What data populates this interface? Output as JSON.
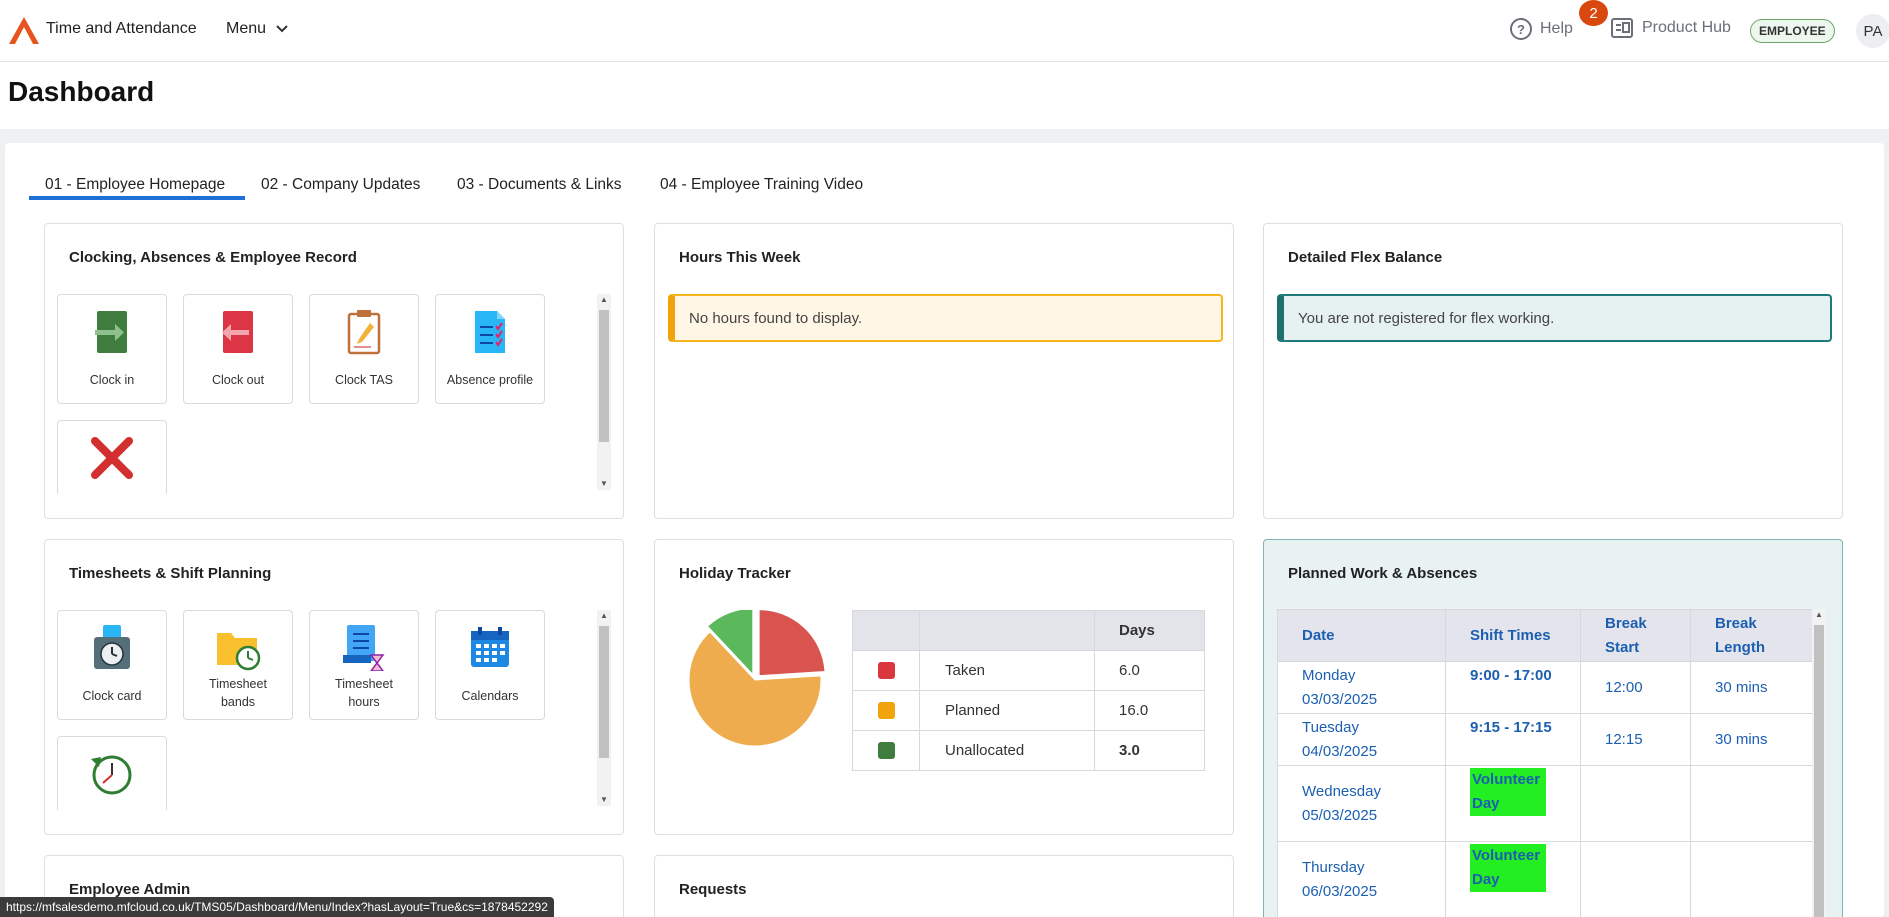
{
  "header": {
    "app_title": "Time and Attendance",
    "menu_label": "Menu",
    "help_label": "Help",
    "notification_count": "2",
    "product_hub_label": "Product Hub",
    "role_badge": "EMPLOYEE",
    "avatar_initials": "PA"
  },
  "page": {
    "title": "Dashboard"
  },
  "tabs": [
    {
      "label": "01 - Employee Homepage",
      "active": true
    },
    {
      "label": "02 - Company Updates",
      "active": false
    },
    {
      "label": "03 - Documents & Links",
      "active": false
    },
    {
      "label": "04 - Employee Training Video",
      "active": false
    }
  ],
  "clocking_panel": {
    "title": "Clocking, Absences & Employee Record",
    "tiles": [
      {
        "label": "Clock in",
        "icon": "clock-in-icon"
      },
      {
        "label": "Clock out",
        "icon": "clock-out-icon"
      },
      {
        "label": "Clock TAS",
        "icon": "clipboard-icon"
      },
      {
        "label": "Absence profile",
        "icon": "checklist-icon"
      },
      {
        "label": "",
        "icon": "red-cross-icon"
      }
    ]
  },
  "hours_panel": {
    "title": "Hours This Week",
    "message": "No hours found to display."
  },
  "flex_panel": {
    "title": "Detailed Flex Balance",
    "message": "You are not registered for flex working."
  },
  "timesheets_panel": {
    "title": "Timesheets & Shift Planning",
    "tiles": [
      {
        "label": "Clock card",
        "icon": "clock-card-icon"
      },
      {
        "label_line1": "Timesheet",
        "label_line2": "bands",
        "icon": "folder-clock-icon"
      },
      {
        "label_line1": "Timesheet",
        "label_line2": "hours",
        "icon": "timesheet-hourglass-icon"
      },
      {
        "label": "Calendars",
        "icon": "calendar-icon"
      },
      {
        "label": "",
        "icon": "history-clock-icon"
      }
    ]
  },
  "holiday_panel": {
    "title": "Holiday Tracker",
    "table_header_days": "Days",
    "rows": [
      {
        "label": "Taken",
        "days": "6.0",
        "color": "#d9363e"
      },
      {
        "label": "Planned",
        "days": "16.0",
        "color": "#f0a30a"
      },
      {
        "label": "Unallocated",
        "days": "3.0",
        "color": "#3e7d3e"
      }
    ],
    "pie_slices": [
      {
        "label": "Taken",
        "value": 6.0,
        "color": "#d9534f"
      },
      {
        "label": "Planned",
        "value": 16.0,
        "color": "#eeac4e"
      },
      {
        "label": "Unallocated",
        "value": 3.0,
        "color": "#5cb85c"
      }
    ]
  },
  "planned_panel": {
    "title": "Planned Work & Absences",
    "headers": [
      "Date",
      "Shift Times",
      "Break Start",
      "Break Length"
    ],
    "header_lines": {
      "break_start_1": "Break",
      "break_start_2": "Start",
      "break_length_1": "Break",
      "break_length_2": "Length"
    },
    "rows": [
      {
        "day": "Monday",
        "date": "03/03/2025",
        "shift": "9:00 - 17:00",
        "break_start": "12:00",
        "break_length": "30 mins"
      },
      {
        "day": "Tuesday",
        "date": "04/03/2025",
        "shift": "9:15 - 17:15",
        "break_start": "12:15",
        "break_length": "30 mins"
      },
      {
        "day": "Wednesday",
        "date": "05/03/2025",
        "shift_line1": "Volunteer",
        "shift_line2": "Day",
        "break_start": "",
        "break_length": ""
      },
      {
        "day": "Thursday",
        "date": "06/03/2025",
        "shift_line1": "Volunteer",
        "shift_line2": "Day",
        "break_start": "",
        "break_length": ""
      }
    ]
  },
  "employee_admin_panel": {
    "title": "Employee Admin"
  },
  "requests_panel": {
    "title": "Requests"
  },
  "status_bar": {
    "url": "https://mfsalesdemo.mfcloud.co.uk/TMS05/Dashboard/Menu/Index?hasLayout=True&cs=1878452292"
  }
}
